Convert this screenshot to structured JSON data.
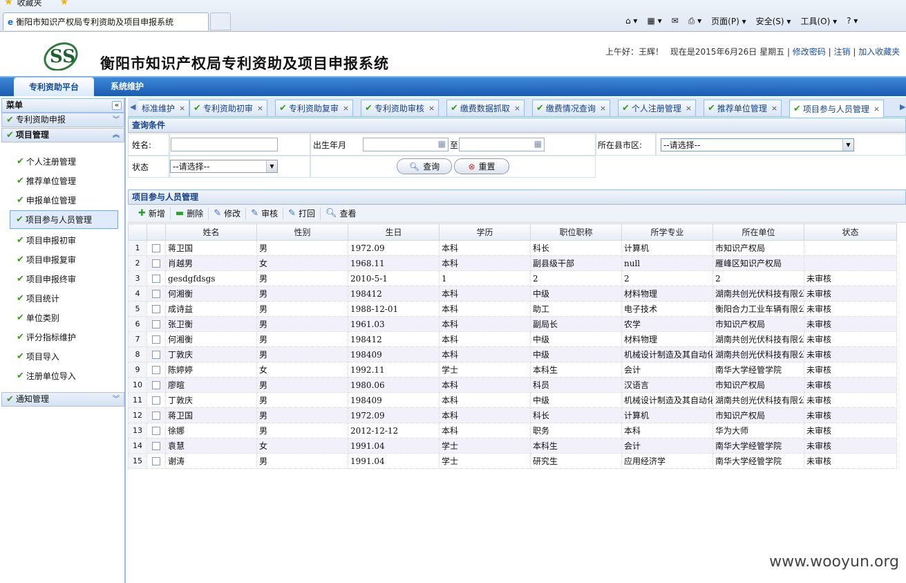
{
  "browser": {
    "favorites_label": "收藏夹",
    "tab_title": "衡阳市知识产权局专利资助及项目申报系统",
    "tools": [
      "页面(P)",
      "安全(S)",
      "工具(O)"
    ]
  },
  "header": {
    "title": "衡阳市知识产权局专利资助及项目申报系统",
    "greeting": "上午好：王辉！",
    "date_text": "现在是2015年6月26日 星期五",
    "links": [
      "修改密码",
      "注销",
      "加入收藏夹"
    ]
  },
  "nav": {
    "tabs": [
      "专利资助平台",
      "系统维护"
    ]
  },
  "sidebar": {
    "title": "菜单",
    "groups": [
      "专利资助申报",
      "项目管理",
      "通知管理"
    ],
    "items": [
      "个人注册管理",
      "推荐单位管理",
      "申报单位管理",
      "项目参与人员管理",
      "项目申报初审",
      "项目申报复审",
      "项目申报终审",
      "项目统计",
      "单位类别",
      "评分指标维护",
      "项目导入",
      "注册单位导入"
    ]
  },
  "content_tabs": [
    "标准维护",
    "专利资助初审",
    "专利资助复审",
    "专利资助审核",
    "缴费数据抓取",
    "缴费情况查询",
    "个人注册管理",
    "推荐单位管理",
    "项目参与人员管理"
  ],
  "query": {
    "title": "查询条件",
    "name_label": "姓名:",
    "birth_label": "出生年月",
    "to_label": "至",
    "county_label": "所在县市区:",
    "county_value": "--请选择--",
    "status_label": "状态",
    "status_value": "--请选择--",
    "search_btn": "查询",
    "reset_btn": "重置"
  },
  "grid": {
    "title": "项目参与人员管理",
    "toolbar": [
      "新增",
      "删除",
      "修改",
      "审核",
      "打回",
      "查看"
    ],
    "columns": [
      "姓名",
      "性别",
      "生日",
      "学历",
      "职位职称",
      "所学专业",
      "所在单位",
      "状态"
    ],
    "rows": [
      [
        "1",
        "蒋卫国",
        "男",
        "1972.09",
        "本科",
        "科长",
        "计算机",
        "市知识产权局",
        ""
      ],
      [
        "2",
        "肖越男",
        "女",
        "1968.11",
        "本科",
        "副县级干部",
        "null",
        "雁峰区知识产权局",
        ""
      ],
      [
        "3",
        "gesdgfdsgs",
        "男",
        "2010-5-1",
        "1",
        "2",
        "2",
        "2",
        "未审核"
      ],
      [
        "4",
        "何湘衡",
        "男",
        "198412",
        "本科",
        "中级",
        "材料物理",
        "湖南共创光伏科技有限公",
        "未审核"
      ],
      [
        "5",
        "成诗益",
        "男",
        "1988-12-01",
        "本科",
        "助工",
        "电子技术",
        "衡阳合力工业车辆有限公",
        "未审核"
      ],
      [
        "6",
        "张卫衡",
        "男",
        "1961.03",
        "本科",
        "副局长",
        "农学",
        "市知识产权局",
        "未审核"
      ],
      [
        "7",
        "何湘衡",
        "男",
        "198412",
        "本科",
        "中级",
        "材料物理",
        "湖南共创光伏科技有限公",
        "未审核"
      ],
      [
        "8",
        "丁敦庆",
        "男",
        "198409",
        "本科",
        "中级",
        "机械设计制造及其自动化",
        "湖南共创光伏科技有限公",
        "未审核"
      ],
      [
        "9",
        "陈婷婷",
        "女",
        "1992.11",
        "学士",
        "本科生",
        "会计",
        "南华大学经管学院",
        "未审核"
      ],
      [
        "10",
        "廖暄",
        "男",
        "1980.06",
        "本科",
        "科员",
        "汉语言",
        "市知识产权局",
        "未审核"
      ],
      [
        "11",
        "丁敦庆",
        "男",
        "198409",
        "本科",
        "中级",
        "机械设计制造及其自动化",
        "湖南共创光伏科技有限公",
        "未审核"
      ],
      [
        "12",
        "蒋卫国",
        "男",
        "1972.09",
        "本科",
        "科长",
        "计算机",
        "市知识产权局",
        "未审核"
      ],
      [
        "13",
        "徐娜",
        "男",
        "2012-12-12",
        "本科",
        "职务",
        "本科",
        "华为大师",
        "未审核"
      ],
      [
        "14",
        "袁慧",
        "女",
        "1991.04",
        "学士",
        "本科生",
        "会计",
        "南华大学经管学院",
        "未审核"
      ],
      [
        "15",
        "谢涛",
        "男",
        "1991.04",
        "学士",
        "研究生",
        "应用经济学",
        "南华大学经管学院",
        "未审核"
      ]
    ]
  },
  "watermark": "www.wooyun.org"
}
